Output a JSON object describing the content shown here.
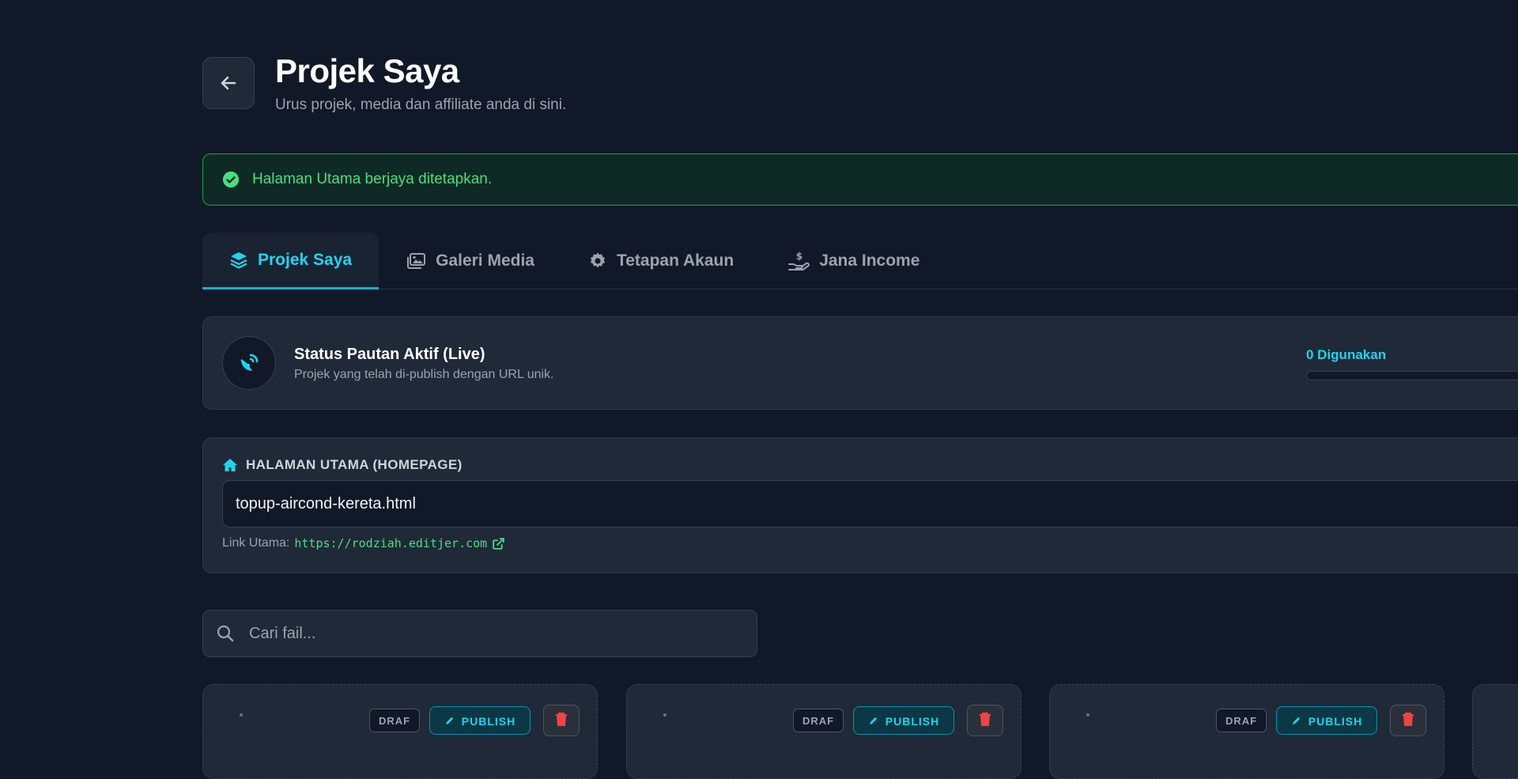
{
  "header": {
    "title": "Projek Saya",
    "subtitle": "Urus projek, media dan affiliate anda di sini."
  },
  "alert": {
    "message": "Halaman Utama berjaya ditetapkan."
  },
  "tabs": [
    {
      "label": "Projek Saya",
      "icon": "layers-icon",
      "active": true
    },
    {
      "label": "Galeri Media",
      "icon": "images-icon",
      "active": false
    },
    {
      "label": "Tetapan Akaun",
      "icon": "gear-icon",
      "active": false
    },
    {
      "label": "Jana Income",
      "icon": "hand-holding-dollar-icon",
      "active": false
    }
  ],
  "status": {
    "title": "Status Pautan Aktif (Live)",
    "description": "Projek yang telah di-publish dengan URL unik.",
    "usage_label": "0 Digunakan",
    "usage_fraction": 0
  },
  "homepage": {
    "heading": "HALAMAN UTAMA (HOMEPAGE)",
    "selected": "topup-aircond-kereta.html",
    "link_label": "Link Utama:",
    "link_url": "https://rodziah.editjer.com"
  },
  "search": {
    "placeholder": "Cari fail..."
  },
  "projects": [
    {
      "draft_label": "DRAF",
      "publish_label": "PUBLISH"
    },
    {
      "draft_label": "DRAF",
      "publish_label": "PUBLISH"
    },
    {
      "draft_label": "DRAF",
      "publish_label": "PUBLISH"
    }
  ],
  "colors": {
    "background": "#111827",
    "card": "#1f2937",
    "accent": "#22d3ee",
    "success": "#4ade80",
    "danger": "#ef4444"
  }
}
